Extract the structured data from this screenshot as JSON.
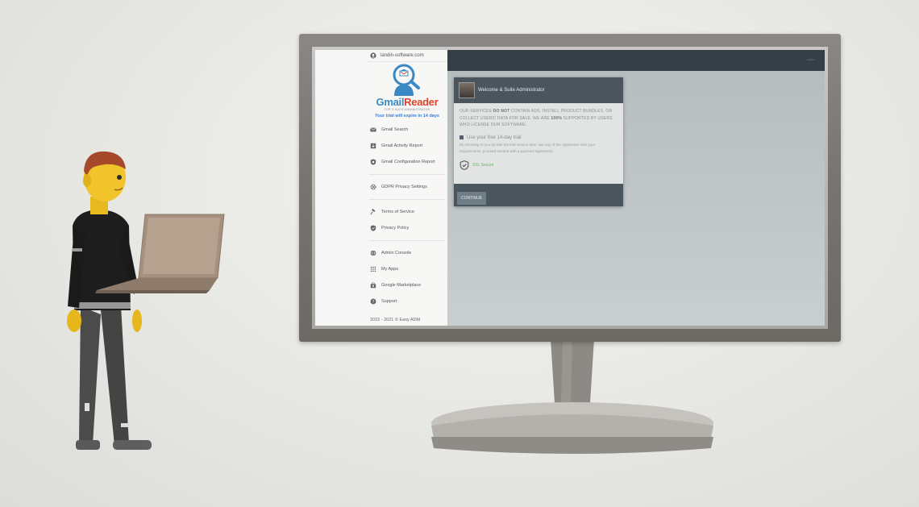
{
  "sidebar": {
    "domain": "landin-software.com",
    "logo": {
      "name_part1": "Gmail",
      "name_part2": "Reader",
      "tagline": "FOR G SUITE ADMINISTRATOR"
    },
    "trial_notice": "Your trial will expire in 14 days",
    "items": [
      {
        "label": "Gmail Search",
        "icon": "envelope-icon"
      },
      {
        "label": "Gmail Activity Report",
        "icon": "download-icon"
      },
      {
        "label": "Gmail Configuration Report",
        "icon": "shield-icon"
      },
      {
        "label": "GDPR Privacy Settings",
        "icon": "gear-icon"
      },
      {
        "label": "Terms of Service",
        "icon": "gavel-icon"
      },
      {
        "label": "Privacy Policy",
        "icon": "shield-check-icon"
      },
      {
        "label": "Admin Console",
        "icon": "globe-icon"
      },
      {
        "label": "My Apps",
        "icon": "apps-grid-icon"
      },
      {
        "label": "Google Marketplace",
        "icon": "store-icon"
      },
      {
        "label": "Support",
        "icon": "help-icon"
      }
    ],
    "footer": "2015 - 2021 © Easy ADM"
  },
  "dialog": {
    "title": "Welcome & Suite Administrator",
    "notice_part1": "OUR SERVICES",
    "notice_bold": "DO NOT",
    "notice_part2": "CONTAIN ADS, INSTALL PRODUCT BUNDLES, OR COLLECT USERS' DATA FOR SALE. WE ARE",
    "notice_bold2": "100%",
    "notice_part3": "SUPPORTED BY USERS WHO LICENSE OUR SOFTWARE.",
    "trial_checkbox_label": "Use your free 14-day trial",
    "trial_note": "By choosing to you do limit the trial version time, use any of the Application with your requirements, proceed needed with a payment agreement.",
    "ssl_label": "SSL Secure",
    "continue_label": "CONTINUE"
  },
  "colors": {
    "brand_blue": "#3b89c4",
    "brand_red": "#d9442f",
    "topbar": "#343f47",
    "ssl_green": "#6fae6a"
  }
}
